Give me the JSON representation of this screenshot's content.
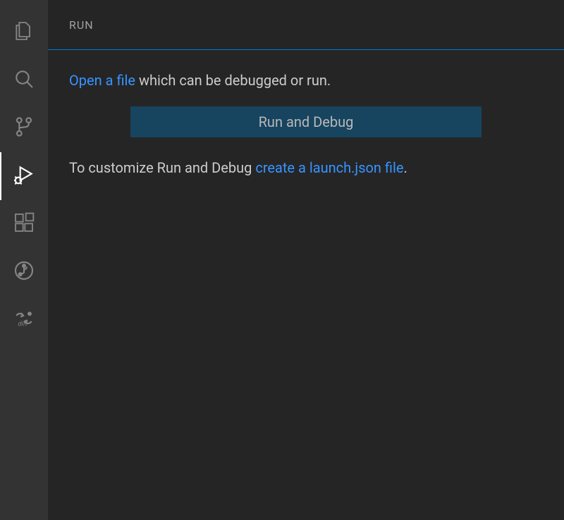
{
  "panel": {
    "title": "RUN",
    "intro_link": "Open a file",
    "intro_text": " which can be debugged or run.",
    "button_label": "Run and Debug",
    "customize_prefix": "To customize Run and Debug ",
    "customize_link": "create a launch.json file",
    "customize_suffix": "."
  },
  "activity_bar": {
    "items": [
      {
        "name": "explorer",
        "active": false
      },
      {
        "name": "search",
        "active": false
      },
      {
        "name": "source-control",
        "active": false
      },
      {
        "name": "run-debug",
        "active": true
      },
      {
        "name": "extensions",
        "active": false
      },
      {
        "name": "git-graph",
        "active": false
      },
      {
        "name": "diff",
        "active": false
      }
    ]
  }
}
